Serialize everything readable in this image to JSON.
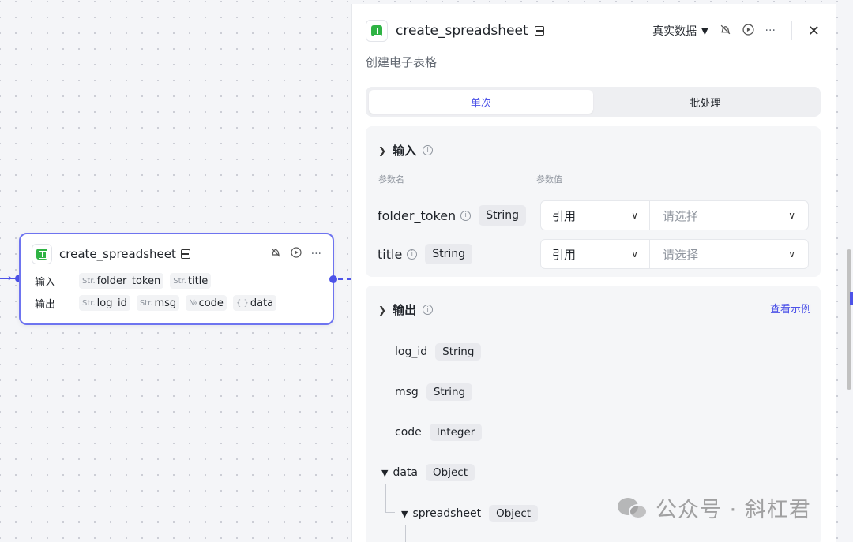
{
  "node": {
    "title": "create_spreadsheet",
    "input_label": "输入",
    "output_label": "输出",
    "inputs": [
      {
        "type_abbr": "Str.",
        "name": "folder_token"
      },
      {
        "type_abbr": "Str.",
        "name": "title"
      }
    ],
    "outputs": [
      {
        "type_abbr": "Str.",
        "name": "log_id"
      },
      {
        "type_abbr": "Str.",
        "name": "msg"
      },
      {
        "type_abbr": "№",
        "name": "code"
      },
      {
        "type_abbr": "{ }",
        "name": "data"
      }
    ]
  },
  "panel": {
    "title": "create_spreadsheet",
    "description": "创建电子表格",
    "mode_label": "真实数据",
    "tabs": [
      {
        "label": "单次",
        "active": true
      },
      {
        "label": "批处理",
        "active": false
      }
    ],
    "input_section": {
      "title": "输入",
      "col_name": "参数名",
      "col_value": "参数值",
      "params": [
        {
          "name": "folder_token",
          "type": "String",
          "source": "引用",
          "placeholder": "请选择"
        },
        {
          "name": "title",
          "type": "String",
          "source": "引用",
          "placeholder": "请选择"
        }
      ]
    },
    "output_section": {
      "title": "输出",
      "example_link": "查看示例",
      "fields": [
        {
          "name": "log_id",
          "type": "String"
        },
        {
          "name": "msg",
          "type": "String"
        },
        {
          "name": "code",
          "type": "Integer"
        },
        {
          "name": "data",
          "type": "Object"
        },
        {
          "name": "spreadsheet",
          "type": "Object"
        }
      ]
    }
  },
  "watermark": {
    "text": "公众号 · 斜杠君"
  },
  "colors": {
    "accent": "#4d53e8",
    "sheet_green": "#2fb344"
  }
}
